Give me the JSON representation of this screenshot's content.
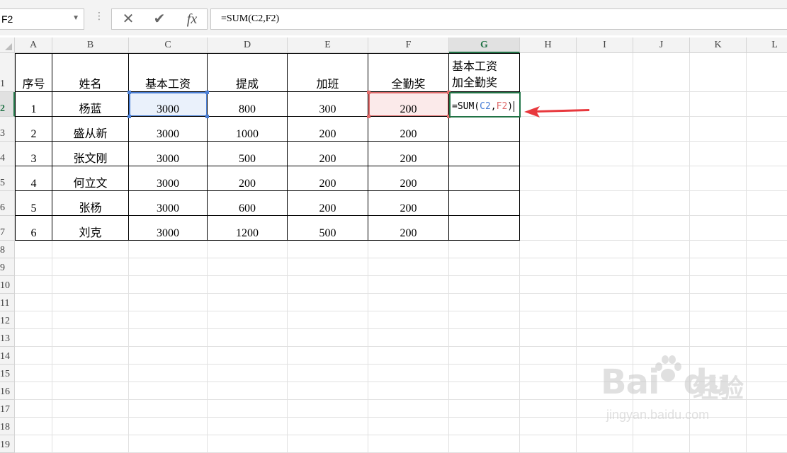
{
  "namebox": {
    "value": "F2"
  },
  "formula_bar": {
    "dots": "⋮",
    "cancel_glyph": "✕",
    "enter_glyph": "✔",
    "fx_label": "fx",
    "value": "=SUM(C2,F2)"
  },
  "columns": [
    "A",
    "B",
    "C",
    "D",
    "E",
    "F",
    "G",
    "H",
    "I",
    "J",
    "K",
    "L"
  ],
  "rows": [
    "1",
    "2",
    "3",
    "4",
    "5",
    "6",
    "7",
    "8",
    "9",
    "10",
    "11",
    "12",
    "13",
    "14",
    "15",
    "16",
    "17",
    "18",
    "19"
  ],
  "selected_column": "G",
  "selected_row": "2",
  "table": {
    "headers": [
      "序号",
      "姓名",
      "基本工资",
      "提成",
      "加班",
      "全勤奖"
    ],
    "g1_line1": "基本工资",
    "g1_line2": "加全勤奖",
    "rows": [
      [
        "1",
        "杨蓝",
        "3000",
        "800",
        "300",
        "200"
      ],
      [
        "2",
        "盛从新",
        "3000",
        "1000",
        "200",
        "200"
      ],
      [
        "3",
        "张文刚",
        "3000",
        "500",
        "200",
        "200"
      ],
      [
        "4",
        "何立文",
        "3000",
        "200",
        "200",
        "200"
      ],
      [
        "5",
        "张杨",
        "3000",
        "600",
        "200",
        "200"
      ],
      [
        "6",
        "刘克",
        "3000",
        "1200",
        "500",
        "200"
      ]
    ]
  },
  "edit_cell": {
    "prefix": "=SUM(",
    "ref1": "C2",
    "sep": ",",
    "ref2": "F2",
    "suffix": ")"
  },
  "watermark": {
    "brand": "Bai",
    "brand2": "du",
    "cn": "经验",
    "url": "jingyan.baidu.com"
  },
  "colors": {
    "ref_c": "#4a7fd6",
    "ref_f": "#e06c6c",
    "selection": "#217346",
    "arrow": "#e8383d"
  }
}
